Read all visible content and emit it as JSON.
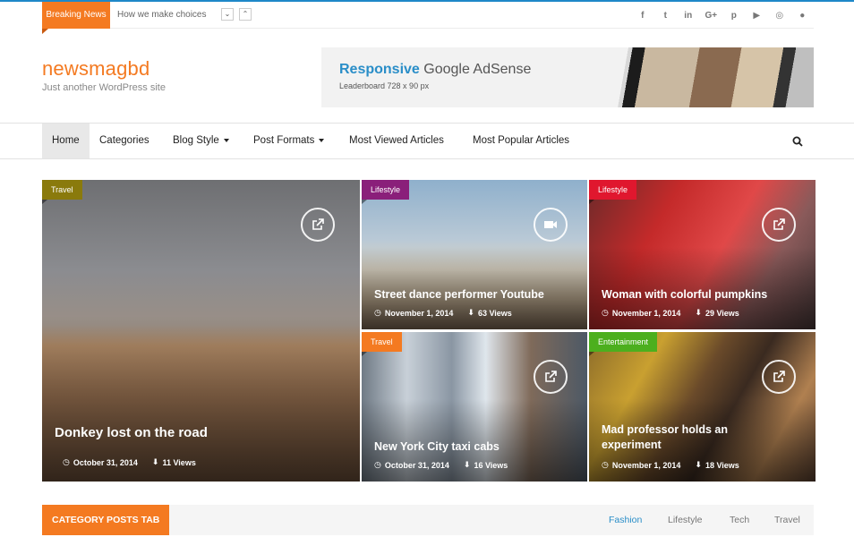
{
  "topbar": {
    "breaking_label": "Breaking News",
    "ticker_text": "How we make choices",
    "prev_glyph": "⌄",
    "next_glyph": "⌃",
    "socials": [
      {
        "icon": "facebook-icon",
        "glyph": "f"
      },
      {
        "icon": "twitter-icon",
        "glyph": "t"
      },
      {
        "icon": "linkedin-icon",
        "glyph": "in"
      },
      {
        "icon": "google-plus-icon",
        "glyph": "G+"
      },
      {
        "icon": "pinterest-icon",
        "glyph": "p"
      },
      {
        "icon": "youtube-icon",
        "glyph": "▶"
      },
      {
        "icon": "instagram-icon",
        "glyph": "◎"
      },
      {
        "icon": "spotify-icon",
        "glyph": "●"
      }
    ]
  },
  "header": {
    "logo": "newsmagbd",
    "tagline": "Just another WordPress site",
    "ad_title_highlight": "Responsive",
    "ad_title_rest": " Google AdSense",
    "ad_subtitle": "Leaderboard 728 x 90 px"
  },
  "nav": {
    "items": [
      {
        "label": "Home",
        "active": true
      },
      {
        "label": "Categories"
      },
      {
        "label": "Blog Style",
        "dropdown": true
      },
      {
        "label": "Post Formats",
        "dropdown": true
      },
      {
        "label": "Most Viewed Articles"
      },
      {
        "label": "Most Popular Articles"
      }
    ]
  },
  "featured": [
    {
      "category": "Travel",
      "category_color": "#8a7a0c",
      "title": "Donkey lost on the road",
      "date": "October 31, 2014",
      "views": "11 Views",
      "format_icon": "external-link-icon"
    },
    {
      "category": "Lifestyle",
      "category_color": "#8a1f7a",
      "title": "Street dance performer Youtube",
      "date": "November 1, 2014",
      "views": "63 Views",
      "format_icon": "video-icon"
    },
    {
      "category": "Lifestyle",
      "category_color": "#e0172e",
      "title": "Woman with colorful pumpkins",
      "date": "November 1, 2014",
      "views": "29 Views",
      "format_icon": "external-link-icon"
    },
    {
      "category": "Travel",
      "category_color": "#f47a21",
      "title": "New York City taxi cabs",
      "date": "October 31, 2014",
      "views": "16 Views",
      "format_icon": "external-link-icon"
    },
    {
      "category": "Entertainment",
      "category_color": "#4caf1e",
      "title": "Mad professor holds an experiment",
      "date": "November 1, 2014",
      "views": "18 Views",
      "format_icon": "external-link-icon"
    }
  ],
  "category_tabs": {
    "title": "CATEGORY POSTS TAB",
    "tabs": [
      {
        "label": "Fashion",
        "active": true
      },
      {
        "label": "Lifestyle"
      },
      {
        "label": "Tech"
      },
      {
        "label": "Travel"
      }
    ]
  },
  "colors": {
    "accent": "#f47a21",
    "link": "#2a8ec8"
  }
}
